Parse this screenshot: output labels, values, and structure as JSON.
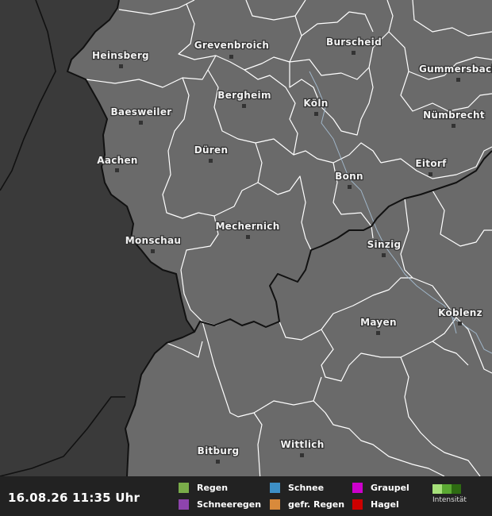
{
  "map": {
    "cities": [
      {
        "name": "Heinsberg"
      },
      {
        "name": "Grevenbroich"
      },
      {
        "name": "Burscheid"
      },
      {
        "name": "Gummersbach"
      },
      {
        "name": "Bergheim"
      },
      {
        "name": "Köln"
      },
      {
        "name": "Baesweiler"
      },
      {
        "name": "Nümbrecht"
      },
      {
        "name": "Düren"
      },
      {
        "name": "Aachen"
      },
      {
        "name": "Bonn"
      },
      {
        "name": "Eitorf"
      },
      {
        "name": "Mechernich"
      },
      {
        "name": "Monschau"
      },
      {
        "name": "Sinzig"
      },
      {
        "name": "Mayen"
      },
      {
        "name": "Koblenz"
      },
      {
        "name": "Bitburg"
      },
      {
        "name": "Wittlich"
      }
    ],
    "colors": {
      "inland": "#6a6a6a",
      "outside": "#3a3a3a",
      "district_border": "#ffffff",
      "country_border": "#111111",
      "rivers": "#a9c3d9"
    }
  },
  "legend": {
    "timestamp": "16.08.26 11:35 Uhr",
    "items": [
      {
        "label": "Regen",
        "color": "#7aac4a"
      },
      {
        "label": "Schneeregen",
        "color": "#8e44ad"
      },
      {
        "label": "Schnee",
        "color": "#3d8fc6"
      },
      {
        "label": "gefr. Regen",
        "color": "#d98a3b"
      },
      {
        "label": "Graupel",
        "color": "#cc00cc"
      },
      {
        "label": "Hagel",
        "color": "#cc0000"
      }
    ],
    "intensity_label": "Intensität",
    "intensity_colors": [
      "#a6e07a",
      "#5aa832",
      "#2e6b12"
    ]
  }
}
